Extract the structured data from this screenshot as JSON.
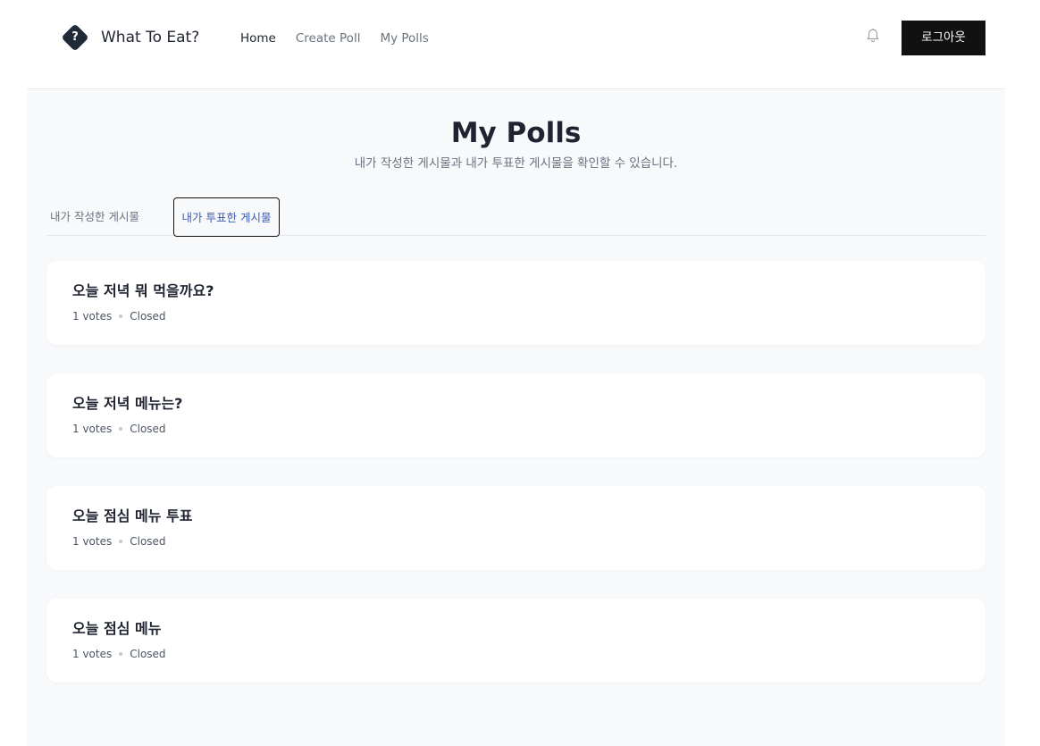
{
  "header": {
    "logo_glyph": "?",
    "app_name": "What To Eat?",
    "nav": [
      {
        "label": "Home",
        "active": true
      },
      {
        "label": "Create Poll",
        "active": false
      },
      {
        "label": "My Polls",
        "active": false
      }
    ],
    "notification_icon": "bell-icon",
    "logout_label": "로그아웃"
  },
  "page": {
    "title": "My Polls",
    "subtitle": "내가 작성한 게시물과 내가 투표한 게시물을 확인할 수 있습니다."
  },
  "tabs": [
    {
      "label": "내가 작성한 게시물",
      "selected": false
    },
    {
      "label": "내가 투표한 게시물",
      "selected": true
    }
  ],
  "polls": [
    {
      "title": "오늘 저녁 뭐 먹을까요?",
      "votes": "1 votes",
      "status": "Closed"
    },
    {
      "title": "오늘 저녁 메뉴는?",
      "votes": "1 votes",
      "status": "Closed"
    },
    {
      "title": "오늘 점심 메뉴 투표",
      "votes": "1 votes",
      "status": "Closed"
    },
    {
      "title": "오늘 점심 메뉴",
      "votes": "1 votes",
      "status": "Closed"
    }
  ],
  "colors": {
    "logout_bg": "#111111",
    "active_tab_text": "#3b5bb5",
    "page_bg": "#f8f9fb"
  }
}
